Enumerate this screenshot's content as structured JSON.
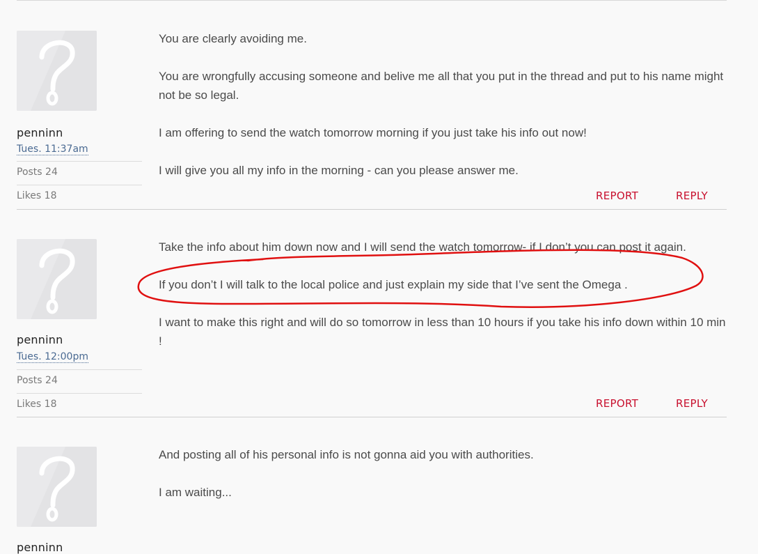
{
  "posts": [
    {
      "username": "penninn",
      "timestamp": "Tues. 11:37am",
      "posts_stat": "Posts 24",
      "likes_stat": "Likes 18",
      "paragraphs": [
        "You are clearly avoiding me.",
        "You are wrongfully accusing someone and belive me all that you put in the thread and put to his name might not be so legal.",
        "I am offering to send the watch tomorrow morning if you just take his info out now!",
        "I will give you all my info in the morning - can you please answer me."
      ],
      "report_label": "REPORT",
      "reply_label": "REPLY"
    },
    {
      "username": "penninn",
      "timestamp": "Tues. 12:00pm",
      "posts_stat": "Posts 24",
      "likes_stat": "Likes 18",
      "paragraphs": [
        "Take the info about him down now and I will send the watch tomorrow- if I don’t you can post it again.",
        "If you don’t I will talk to the local police and just explain my side that I’ve sent the Omega .",
        "I want to make this right and will do so tomorrow in less than 10 hours if you take his info down within 10 min !"
      ],
      "report_label": "REPORT",
      "reply_label": "REPLY"
    },
    {
      "username": "penninn",
      "paragraphs": [
        "And posting all of his personal info is not gonna aid you with authorities.",
        "I am waiting..."
      ]
    }
  ],
  "colors": {
    "accent": "#c8102e",
    "timestamp": "#4a6a92",
    "annotation": "#e01010",
    "background": "#f9f9f9"
  },
  "icons": {
    "avatar": "question-mark-avatar-icon"
  }
}
